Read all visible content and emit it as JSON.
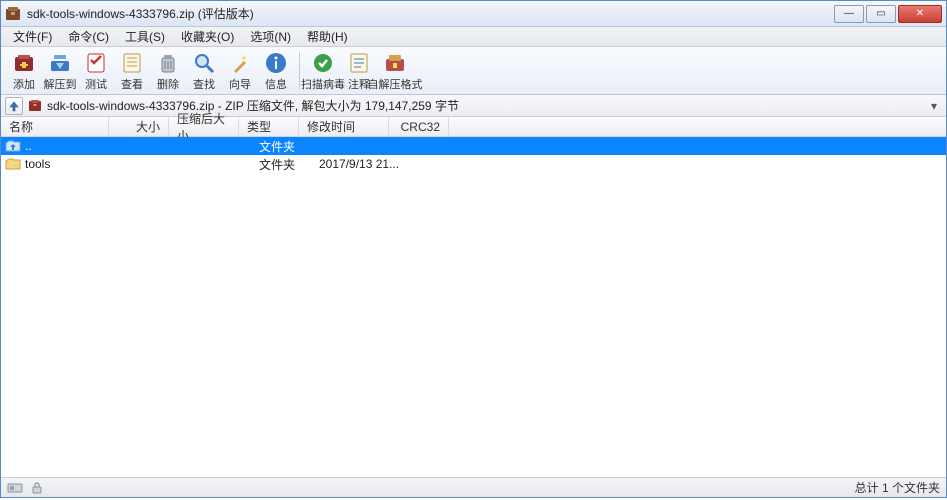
{
  "title": "sdk-tools-windows-4333796.zip (评估版本)",
  "menus": [
    "文件(F)",
    "命令(C)",
    "工具(S)",
    "收藏夹(O)",
    "选项(N)",
    "帮助(H)"
  ],
  "toolbar": [
    {
      "label": "添加",
      "icon": "add"
    },
    {
      "label": "解压到",
      "icon": "extract"
    },
    {
      "label": "测试",
      "icon": "test"
    },
    {
      "label": "查看",
      "icon": "view"
    },
    {
      "label": "删除",
      "icon": "delete"
    },
    {
      "label": "查找",
      "icon": "find"
    },
    {
      "label": "向导",
      "icon": "wizard"
    },
    {
      "label": "信息",
      "icon": "info"
    },
    {
      "sep": true
    },
    {
      "label": "扫描病毒",
      "icon": "virus"
    },
    {
      "label": "注释",
      "icon": "comment"
    },
    {
      "label": "自解压格式",
      "icon": "sfx"
    }
  ],
  "path": "sdk-tools-windows-4333796.zip - ZIP 压缩文件, 解包大小为 179,147,259 字节",
  "columns": {
    "name": "名称",
    "size": "大小",
    "packed": "压缩后大小",
    "type": "类型",
    "modified": "修改时间",
    "crc": "CRC32"
  },
  "rows": [
    {
      "name": "..",
      "type": "文件夹",
      "modified": "",
      "selected": true,
      "icon": "up-folder"
    },
    {
      "name": "tools",
      "type": "文件夹",
      "modified": "2017/9/13 21...",
      "selected": false,
      "icon": "folder"
    }
  ],
  "status": {
    "left_icons": [
      "disk",
      "lock"
    ],
    "summary": "总计 1 个文件夹"
  }
}
